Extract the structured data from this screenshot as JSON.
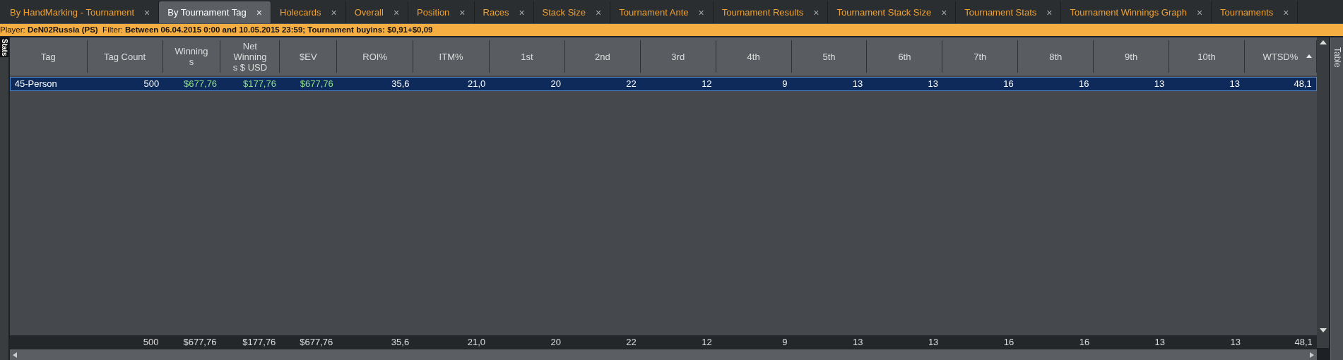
{
  "tabs": [
    {
      "label": "By HandMarking - Tournament",
      "selected": false
    },
    {
      "label": "By Tournament Tag",
      "selected": true
    },
    {
      "label": "Holecards",
      "selected": false
    },
    {
      "label": "Overall",
      "selected": false
    },
    {
      "label": "Position",
      "selected": false
    },
    {
      "label": "Races",
      "selected": false
    },
    {
      "label": "Stack Size",
      "selected": false
    },
    {
      "label": "Tournament Ante",
      "selected": false
    },
    {
      "label": "Tournament Results",
      "selected": false
    },
    {
      "label": "Tournament Stack Size",
      "selected": false
    },
    {
      "label": "Tournament Stats",
      "selected": false
    },
    {
      "label": "Tournament Winnings Graph",
      "selected": false
    },
    {
      "label": "Tournaments",
      "selected": false
    }
  ],
  "close_glyph": "×",
  "filter_bar": "Player: **DeN02Russia (PS)**  Filter: **Between 06.04.2015 0:00 and 10.05.2015 23:59; Tournament buyins: $0,91+$0,09**",
  "left_panel_tab": "Stats",
  "right_panel_tab": "Table",
  "table": {
    "columns": [
      {
        "label": "Tag",
        "kind": "text",
        "sorted": false
      },
      {
        "label": "Tag Count",
        "kind": "number",
        "sorted": false
      },
      {
        "label": "Winnings",
        "kind": "money",
        "sorted": false
      },
      {
        "label": "Net Winnings $ USD",
        "kind": "money",
        "sorted": false
      },
      {
        "label": "$EV",
        "kind": "money",
        "sorted": false
      },
      {
        "label": "ROI%",
        "kind": "number",
        "sorted": false
      },
      {
        "label": "ITM%",
        "kind": "number",
        "sorted": false
      },
      {
        "label": "1st",
        "kind": "number",
        "sorted": false
      },
      {
        "label": "2nd",
        "kind": "number",
        "sorted": false
      },
      {
        "label": "3rd",
        "kind": "number",
        "sorted": false
      },
      {
        "label": "4th",
        "kind": "number",
        "sorted": false
      },
      {
        "label": "5th",
        "kind": "number",
        "sorted": false
      },
      {
        "label": "6th",
        "kind": "number",
        "sorted": false
      },
      {
        "label": "7th",
        "kind": "number",
        "sorted": false
      },
      {
        "label": "8th",
        "kind": "number",
        "sorted": false
      },
      {
        "label": "9th",
        "kind": "number",
        "sorted": false
      },
      {
        "label": "10th",
        "kind": "number",
        "sorted": false
      },
      {
        "label": "WTSD%",
        "kind": "number",
        "sorted": true
      }
    ],
    "rows": [
      {
        "selected": true,
        "cells": [
          "45-Person",
          "500",
          "$677,76",
          "$177,76",
          "$677,76",
          "35,6",
          "21,0",
          "20",
          "22",
          "12",
          "9",
          "13",
          "13",
          "16",
          "16",
          "13",
          "13",
          "48,1"
        ]
      }
    ],
    "totals": [
      "500",
      "$677,76",
      "$177,76",
      "$677,76",
      "35,6",
      "21,0",
      "20",
      "22",
      "12",
      "9",
      "13",
      "13",
      "16",
      "16",
      "13",
      "13",
      "48,1"
    ]
  }
}
